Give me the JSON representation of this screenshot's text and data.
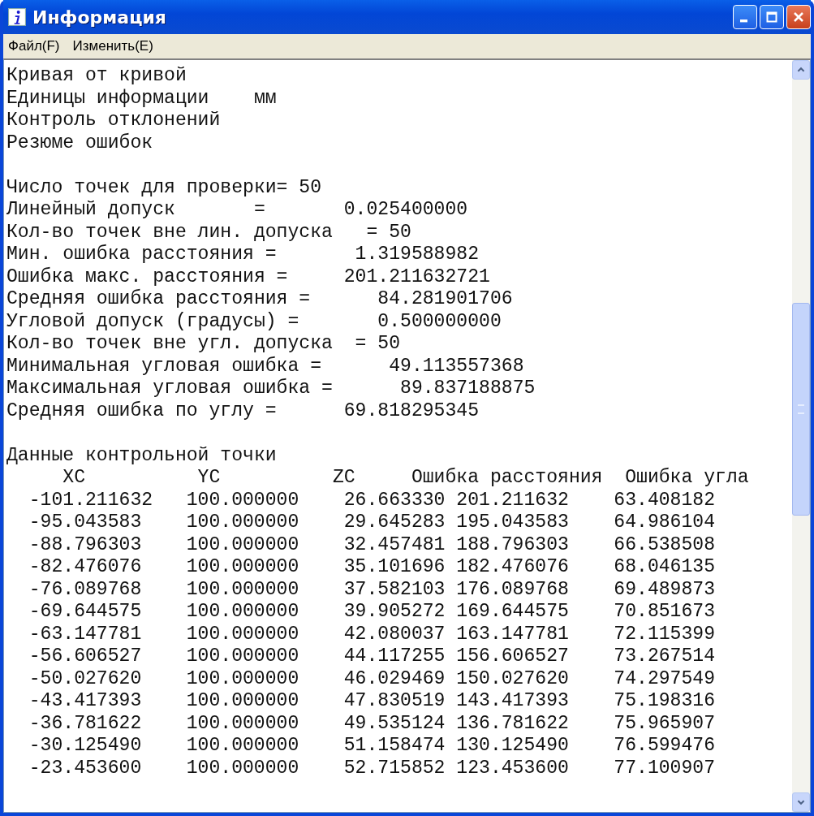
{
  "window": {
    "title": "Информация"
  },
  "menu": [
    "Файл(F)",
    "Изменить(E)"
  ],
  "report": {
    "blocks": [
      [
        "Кривая от кривой",
        "Единицы информации    мм",
        "Контроль отклонений",
        "Резюме ошибок"
      ],
      [
        "Число точек для проверки= 50",
        "Линейный допуск       =       0.025400000",
        "Кол-во точек вне лин. допуска   = 50",
        "Мин. ошибка расстояния =       1.319588982",
        "Ошибка макс. расстояния =     201.211632721",
        "Средняя ошибка расстояния =      84.281901706",
        "Угловой допуск (градусы) =       0.500000000",
        "Кол-во точек вне угл. допуска  = 50",
        "Минимальная угловая ошибка =      49.113557368",
        "Максимальная угловая ошибка =      89.837188875",
        "Средняя ошибка по углу =      69.818295345"
      ]
    ]
  },
  "table": {
    "title": "Данные контрольной точки",
    "columns": [
      "XC",
      "YC",
      "ZC",
      "Ошибка расстояния",
      "Ошибка угла"
    ],
    "rows": [
      [
        "-101.211632",
        "100.000000",
        "26.663330",
        "201.211632",
        "63.408182"
      ],
      [
        "-95.043583",
        "100.000000",
        "29.645283",
        "195.043583",
        "64.986104"
      ],
      [
        "-88.796303",
        "100.000000",
        "32.457481",
        "188.796303",
        "66.538508"
      ],
      [
        "-82.476076",
        "100.000000",
        "35.101696",
        "182.476076",
        "68.046135"
      ],
      [
        "-76.089768",
        "100.000000",
        "37.582103",
        "176.089768",
        "69.489873"
      ],
      [
        "-69.644575",
        "100.000000",
        "39.905272",
        "169.644575",
        "70.851673"
      ],
      [
        "-63.147781",
        "100.000000",
        "42.080037",
        "163.147781",
        "72.115399"
      ],
      [
        "-56.606527",
        "100.000000",
        "44.117255",
        "156.606527",
        "73.267514"
      ],
      [
        "-50.027620",
        "100.000000",
        "46.029469",
        "150.027620",
        "74.297549"
      ],
      [
        "-43.417393",
        "100.000000",
        "47.830519",
        "143.417393",
        "75.198316"
      ],
      [
        "-36.781622",
        "100.000000",
        "49.535124",
        "136.781622",
        "75.965907"
      ],
      [
        "-30.125490",
        "100.000000",
        "51.158474",
        "130.125490",
        "76.599476"
      ],
      [
        "-23.453600",
        "100.000000",
        "52.715852",
        "123.453600",
        "77.100907"
      ]
    ]
  }
}
